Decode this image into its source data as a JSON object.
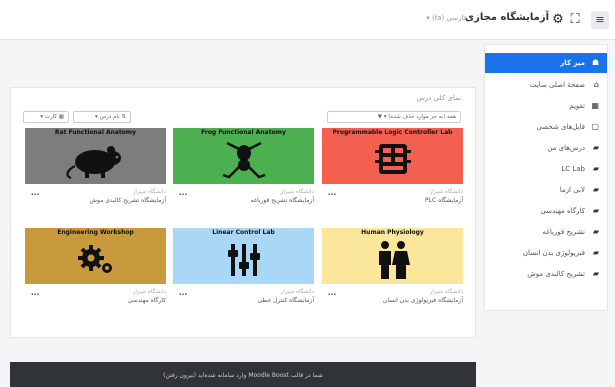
{
  "header": {
    "brand": "آزمایشگاه مجازی",
    "lang_label": "فارسی (fa) ▾",
    "menu_icon": "hamburger-icon",
    "settings_icon": "gear-icon",
    "expand_icon": "fullscreen-icon"
  },
  "sidebar": {
    "items": [
      {
        "label": "میز کار",
        "icon": "dashboard-icon",
        "active": true
      },
      {
        "label": "صفحهٔ اصلی سایت",
        "icon": "home-icon",
        "active": false
      },
      {
        "label": "تقویم",
        "icon": "calendar-icon",
        "active": false
      },
      {
        "label": "فایل‌های شخصی",
        "icon": "file-icon",
        "active": false
      },
      {
        "label": "درس‌های من",
        "icon": "graduation-icon",
        "active": false
      },
      {
        "label": "LC Lab",
        "icon": "graduation-icon",
        "active": false
      },
      {
        "label": "لابی ازما",
        "icon": "graduation-icon",
        "active": false
      },
      {
        "label": "کارگاه مهندسی",
        "icon": "graduation-icon",
        "active": false
      },
      {
        "label": "تشریح قورباغه",
        "icon": "graduation-icon",
        "active": false
      },
      {
        "label": "فیزیولوژی بدن انسان",
        "icon": "graduation-icon",
        "active": false
      },
      {
        "label": "تشریح کالبدی موش",
        "icon": "graduation-icon",
        "active": false
      }
    ]
  },
  "main": {
    "title": "نمای کلی درس",
    "filter_label": "همه (به جز موارد حذف شده) ▾",
    "sort_label": "نام درس ▾",
    "view_label": "کارت ▾"
  },
  "courses": [
    {
      "header": "Rat Functional Anatomy",
      "org": "دانشگاه شیراز",
      "name": "آزمایشگاه تشریح کالبدی موش",
      "bg": "#7d7d7d"
    },
    {
      "header": "Frog Functional Anatomy",
      "org": "دانشگاه شیراز",
      "name": "آزمایشگاه تشریح قورباغه",
      "bg": "#4caf50"
    },
    {
      "header": "Programmable Logic Controller Lab",
      "org": "دانشگاه شیراز",
      "name": "آزمایشگاه PLC",
      "bg": "#f4604f"
    },
    {
      "header": "Engineering Workshop",
      "org": "دانشگاه شیراز",
      "name": "کارگاه مهندسی",
      "bg": "#c99a3c"
    },
    {
      "header": "Linear Control Lab",
      "org": "دانشگاه شیراز",
      "name": "آزمایشگاه کنترل خطی",
      "bg": "#a9d8f7"
    },
    {
      "header": "Human Physiology",
      "org": "دانشگاه شیراز",
      "name": "آزمایشگاه فیزیولوژی بدن انسان",
      "bg": "#fbe79b"
    }
  ],
  "footer": {
    "text": "شما در قالب Moodle Boost وارد سامانه شده‌اید (بیرون رفتن)"
  }
}
